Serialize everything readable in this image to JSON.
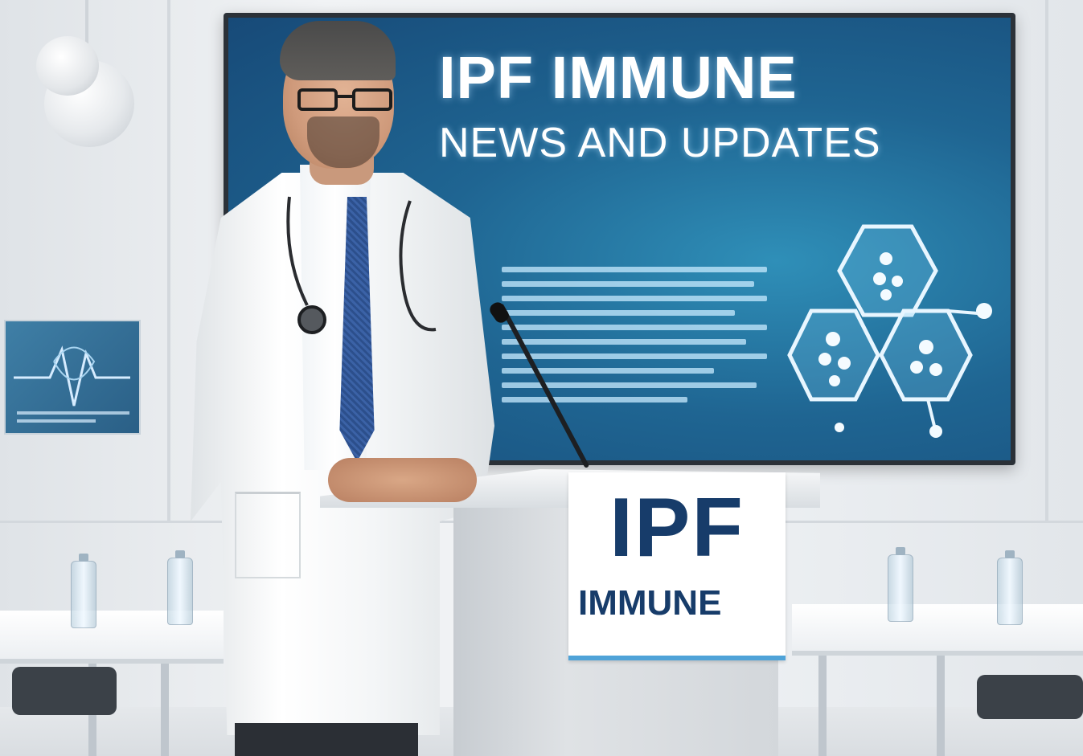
{
  "screen": {
    "title": "IPF IMMUNE",
    "subtitle": "NEWS AND UPDATES"
  },
  "podium_sign": {
    "main": "IPF",
    "sub": "IMMUNE"
  },
  "colors": {
    "screen_blue": "#1f6592",
    "sign_text_navy": "#173c6a",
    "coat_white": "#ffffff",
    "tie_blue": "#2c4f8c"
  },
  "icons": {
    "screen_graphic": "hexagonal-cell-molecule-icon",
    "wall_sign_graphic": "heartbeat-wave-icon"
  }
}
